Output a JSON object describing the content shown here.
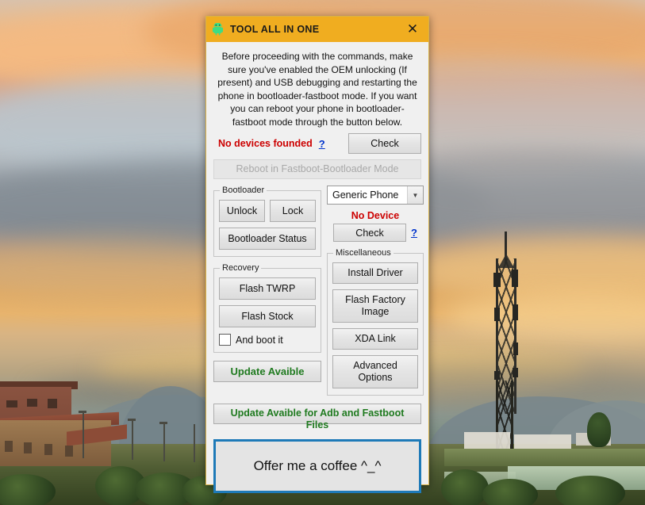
{
  "window": {
    "title": "TOOL ALL IN ONE",
    "icon": "android-robot-icon",
    "close_label": "✕",
    "accent_color": "#f0ad20"
  },
  "instructions": "Before proceeding with the commands, make sure you've enabled the OEM unlocking (If present) and USB debugging and restarting the phone in bootloader-fastboot mode. If you want you can reboot your phone in bootloader-fastboot mode through the button below.",
  "device_status": {
    "text": "No devices founded",
    "color": "#cc0000",
    "help_label": "?",
    "check_label": "Check"
  },
  "reboot": {
    "label": "Reboot in Fastboot-Bootloader Mode",
    "enabled": false
  },
  "bootloader_group": {
    "legend": "Bootloader",
    "unlock_label": "Unlock",
    "lock_label": "Lock",
    "status_label": "Bootloader Status"
  },
  "recovery_group": {
    "legend": "Recovery",
    "flash_twrp_label": "Flash TWRP",
    "flash_stock_label": "Flash Stock",
    "and_boot_it_label": "And boot it",
    "and_boot_it_checked": false
  },
  "update_button": {
    "label": "Update Avaible",
    "color": "#1f7a1f"
  },
  "device_select": {
    "selected": "Generic Phone",
    "arrow": "▼"
  },
  "right_status": {
    "text": "No Device",
    "color": "#cc0000",
    "check_label": "Check",
    "help_label": "?"
  },
  "misc_group": {
    "legend": "Miscellaneous",
    "buttons": [
      {
        "label": "Install Driver"
      },
      {
        "label": "Flash Factory Image"
      },
      {
        "label": "XDA Link"
      },
      {
        "label": "Advanced Options"
      }
    ]
  },
  "update_files_button": {
    "label": "Update Avaible for Adb and Fastboot Files",
    "color": "#1f7a1f"
  },
  "coffee_button": {
    "label": "Offer me a coffee ^_^",
    "border_color": "#1e7ab8"
  },
  "desktop": {
    "wallpaper_description": "Sunset photograph of a town with apartment buildings, a cell tower, mountains and orange clouds"
  }
}
